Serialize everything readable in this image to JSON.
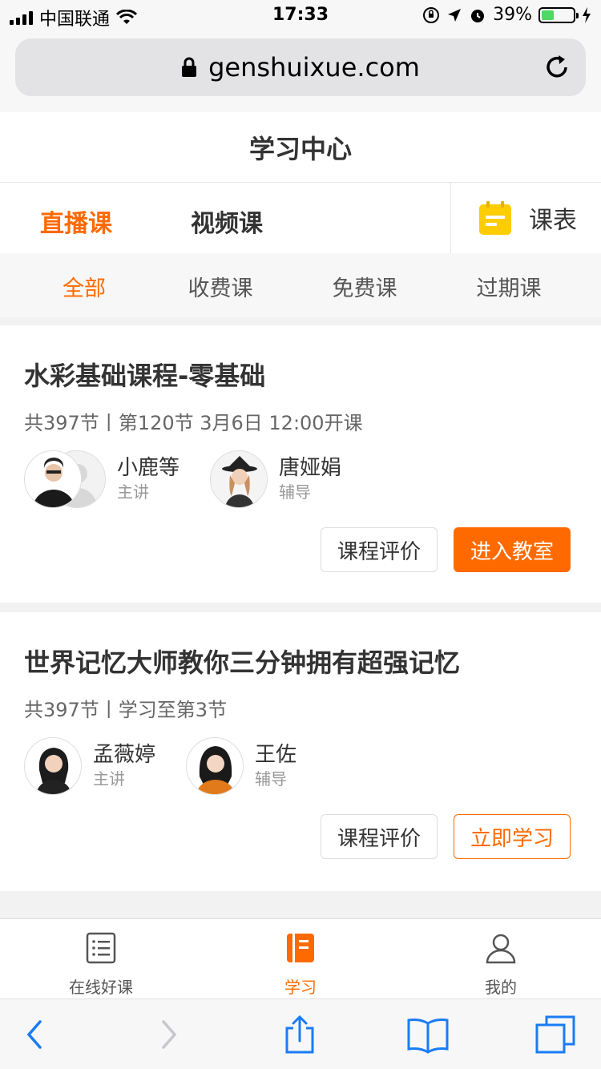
{
  "status_bar": {
    "carrier": "中国联通",
    "time": "17:33",
    "battery": "39%",
    "battery_level": 0.39
  },
  "browser": {
    "url": "genshuixue.com"
  },
  "page": {
    "title": "学习中心"
  },
  "tabs": {
    "live": "直播课",
    "video": "视频课",
    "schedule": "课表"
  },
  "filters": [
    "全部",
    "收费课",
    "免费课",
    "过期课"
  ],
  "courses": [
    {
      "title": "水彩基础课程-零基础",
      "meta": "共397节丨第120节 3月6日 12:00开课",
      "teachers": [
        {
          "name": "小鹿等",
          "role": "主讲"
        },
        {
          "name": "唐娅娟",
          "role": "辅导"
        }
      ],
      "btn_review": "课程评价",
      "btn_action": "进入教室"
    },
    {
      "title": "世界记忆大师教你三分钟拥有超强记忆",
      "meta": "共397节丨学习至第3节",
      "teachers": [
        {
          "name": "孟薇婷",
          "role": "主讲"
        },
        {
          "name": "王佐",
          "role": "辅导"
        }
      ],
      "btn_review": "课程评价",
      "btn_action": "立即学习"
    }
  ],
  "bottom_nav": [
    "在线好课",
    "学习",
    "我的"
  ],
  "colors": {
    "accent": "#ff6a00",
    "schedule_icon": "#ffcc00"
  }
}
